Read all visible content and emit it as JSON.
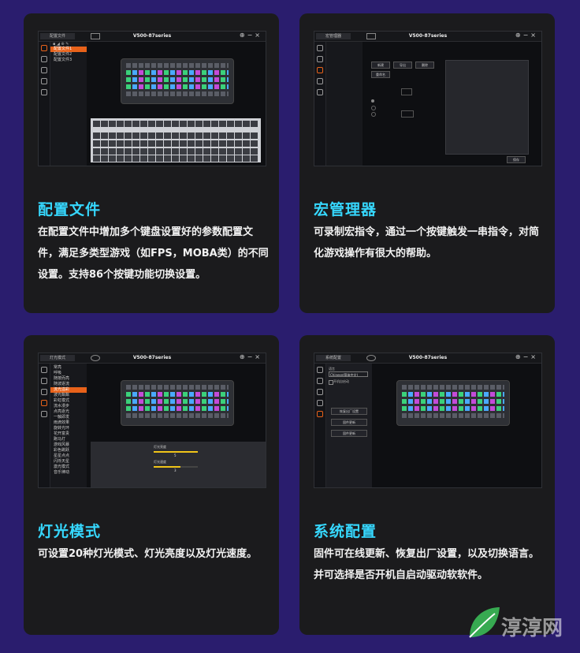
{
  "cards": [
    {
      "heading": "配置文件",
      "desc": "在配置文件中增加多个键盘设置好的参数配置文件，满足多类型游戏（如FPS，MOBA类）的不同设置。支持86个按键功能切换设置。",
      "window_title": "V500-87series",
      "tab_label": "配置文件",
      "list": [
        "配置文件1",
        "配置文件2",
        "配置文件3"
      ]
    },
    {
      "heading": "宏管理器",
      "desc": "可录制宏指令，通过一个按键触发一串指令，对简化游戏操作有很大的帮助。",
      "window_title": "V500-87series",
      "tab_label": "宏管理器",
      "buttons": [
        "新建",
        "导出",
        "删除",
        "重命名"
      ],
      "save_label": "保存"
    },
    {
      "heading": "灯光模式",
      "desc": "可设置20种灯光模式、灯光亮度以及灯光速度。",
      "window_title": "V500-87series",
      "tab_label": "灯光模式",
      "brightness_label": "灯光亮度",
      "brightness_value": "5",
      "speed_label": "灯光速度",
      "speed_value": "3",
      "modes": [
        "常亮",
        "呼吸",
        "随按而亮",
        "随波逐流",
        "流光溢彩",
        "波光粼粼",
        "彩虹模式",
        "流水漫步",
        "点亮逐光",
        "一触即发",
        "雨滴效果",
        "旋转光环",
        "花开富贵",
        "跑马灯",
        "游戏风暴",
        "彩色跳跃",
        "星星点点",
        "闪烁天星",
        "激光模式",
        "音乐律动"
      ]
    },
    {
      "heading": "系统配置",
      "desc": "固件可在线更新、恢复出厂设置，以及切换语言。并可选择是否开机自启动驱动软软件。",
      "window_title": "V500-87series",
      "tab_label": "系统配置",
      "language_label": "语言",
      "language_value": "Chinese(简体中文)",
      "autostart_label": "开机自启动",
      "sys_buttons": [
        "恢复出厂设置",
        "固件更新",
        "固件更新"
      ]
    }
  ],
  "watermark_text": "淳淳网",
  "accent_color": "#36d8ff",
  "highlight_color": "#e8621a"
}
